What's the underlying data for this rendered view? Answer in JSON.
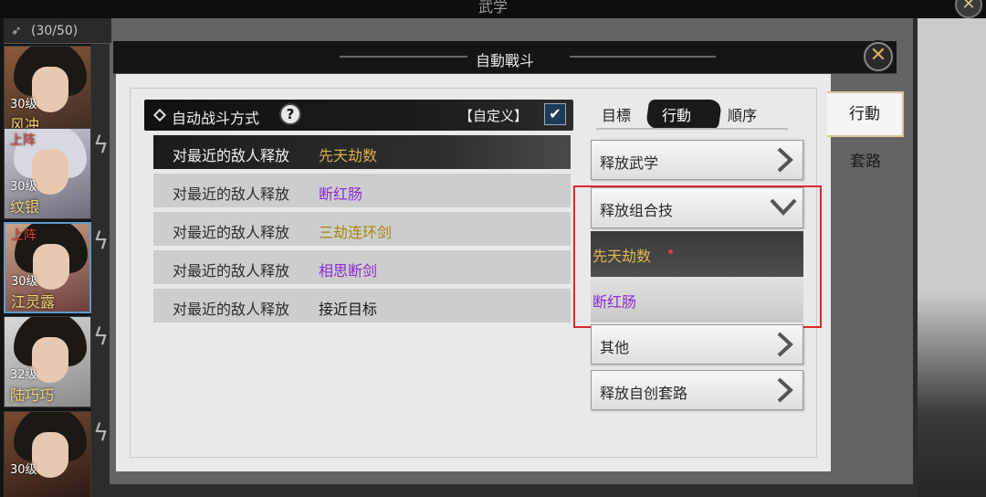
{
  "background": {
    "top_title": "武学",
    "roster_count": "(30/50)",
    "heroes": [
      {
        "level": "30级",
        "name": "风冲",
        "deployed": ""
      },
      {
        "level": "30级",
        "name": "纹银",
        "deployed": "上阵"
      },
      {
        "level": "30级",
        "name": "江灵露",
        "deployed": "上阵"
      },
      {
        "level": "32级",
        "name": "陆巧巧",
        "deployed": ""
      },
      {
        "level": "30级",
        "name": "",
        "deployed": ""
      }
    ]
  },
  "modal": {
    "title": "自動戰斗",
    "close_icon": "close-x-icon"
  },
  "left_panel": {
    "title": "自动战斗方式",
    "help_glyph": "?",
    "custom_label": "【自定义】",
    "custom_checked": true,
    "actions": [
      {
        "desc": "对最近的敌人释放",
        "skill": "先天劫数",
        "color": "#d9b04a",
        "selected": true
      },
      {
        "desc": "对最近的敌人释放",
        "skill": "断红肠",
        "color": "#8a2bd2",
        "selected": false
      },
      {
        "desc": "对最近的敌人释放",
        "skill": "三劫连环剑",
        "color": "#a8860e",
        "selected": false
      },
      {
        "desc": "对最近的敌人释放",
        "skill": "相思断剑",
        "color": "#8a2bd2",
        "selected": false
      },
      {
        "desc": "对最近的敌人释放",
        "skill": "接近目标",
        "color": "#1a1a1a",
        "selected": false
      }
    ]
  },
  "right_panel": {
    "tabs": [
      {
        "label": "目標",
        "active": false
      },
      {
        "label": "行動",
        "active": true
      },
      {
        "label": "順序",
        "active": false
      }
    ],
    "menu": {
      "release_skill": "释放武学",
      "release_combo": "释放组合技",
      "combo_items": [
        {
          "label": "先天劫数",
          "color": "#e0b84e",
          "highlighted": true
        },
        {
          "label": "断红肠",
          "color": "#8a2bd2",
          "highlighted": false
        }
      ],
      "other": "其他",
      "release_custom": "释放自创套路"
    }
  },
  "side_tabs": {
    "active": "行動",
    "inactive": "套路"
  }
}
